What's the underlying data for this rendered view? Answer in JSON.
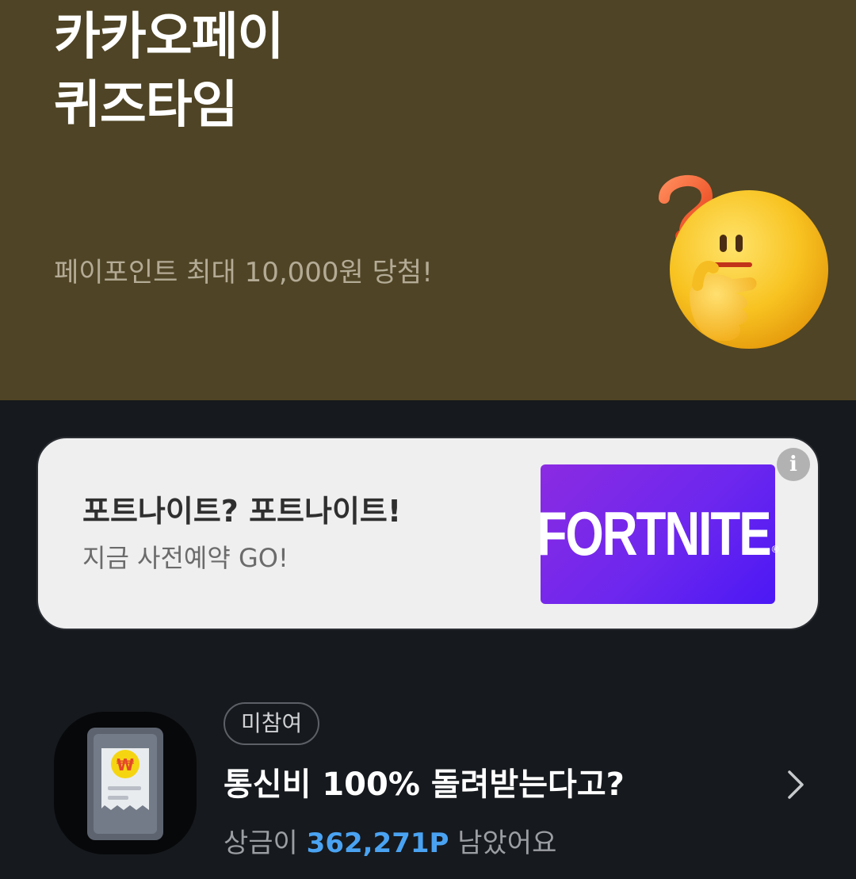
{
  "hero": {
    "title_line1": "카카오페이",
    "title_line2": "퀴즈타임",
    "subtitle": "페이포인트 최대 10,000원 당첨!",
    "emoji_icon": "thinking-face-with-question-mark",
    "background": "#4f4425"
  },
  "ad": {
    "title": "포트나이트? 포트나이트!",
    "subtitle": "지금 사전예약 GO!",
    "image_text": "FORTNITE",
    "image_reg": "®",
    "info_icon": "i"
  },
  "quiz": {
    "badge": "미참여",
    "title": "통신비 100% 돌려받는다고?",
    "prize_prefix": "상금이 ",
    "prize_amount": "362,271P",
    "prize_suffix": " 남았어요",
    "accent": "#4aa3f2",
    "icon": "receipt-won-icon"
  }
}
